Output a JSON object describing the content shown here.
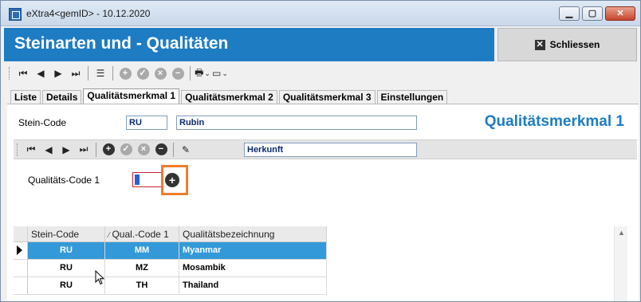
{
  "window": {
    "title": "eXtra4<gemID>  -  10.12.2020"
  },
  "header": {
    "title": "Steinarten und - Qualitäten",
    "close_label": "Schliessen"
  },
  "tabs": [
    {
      "label": "Liste"
    },
    {
      "label": "Details"
    },
    {
      "label": "Qualitätsmerkmal 1"
    },
    {
      "label": "Qualitätsmerkmal 2"
    },
    {
      "label": "Qualitätsmerkmal 3"
    },
    {
      "label": "Einstellungen"
    }
  ],
  "form": {
    "stein_code_label": "Stein-Code",
    "stein_code_value": "RU",
    "stein_name_value": "Rubin",
    "section_title": "Qualitätsmerkmal 1",
    "herkunft_value": "Herkunft",
    "qual_code_label": "Qualitäts-Code 1"
  },
  "grid": {
    "columns": [
      "Stein-Code",
      "Qual.-Code 1",
      "Qualitätsbezeichnung"
    ],
    "rows": [
      {
        "stein": "RU",
        "code": "MM",
        "name": "Myanmar"
      },
      {
        "stein": "RU",
        "code": "MZ",
        "name": "Mosambik"
      },
      {
        "stein": "RU",
        "code": "TH",
        "name": "Thailand"
      }
    ]
  },
  "colors": {
    "header_blue": "#1e7cc3",
    "selected_row": "#3399d9",
    "highlight": "#f07c2a"
  }
}
